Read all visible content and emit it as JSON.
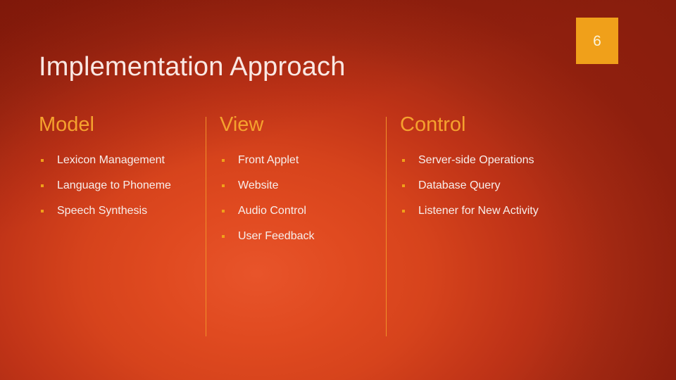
{
  "slide": {
    "title": "Implementation Approach",
    "number": "6",
    "colors": {
      "background_dark": "#97220f",
      "background_bright": "#e8542a",
      "accent_orange": "#f5a22e",
      "badge": "#f0a01a",
      "title_text": "#fae8e3",
      "body_text": "#f7efec",
      "divider": "#f0912a"
    }
  },
  "columns": [
    {
      "header": "Model",
      "items": [
        "Lexicon Management",
        "Language to Phoneme",
        "Speech Synthesis"
      ]
    },
    {
      "header": "View",
      "items": [
        "Front Applet",
        "Website",
        "Audio Control",
        "User Feedback"
      ]
    },
    {
      "header": "Control",
      "items": [
        "Server-side Operations",
        "Database Query",
        "Listener for New Activity"
      ]
    }
  ]
}
